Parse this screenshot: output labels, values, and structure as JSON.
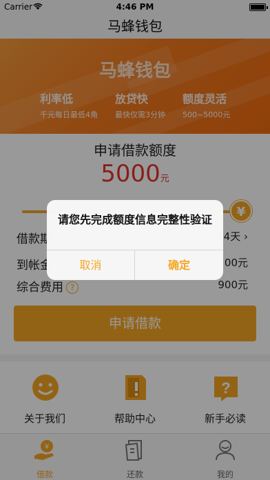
{
  "status_bar": {
    "carrier": "Carrier",
    "time": "4:46 PM"
  },
  "nav": {
    "title": "马蜂钱包"
  },
  "banner": {
    "brand": "马蜂钱包",
    "features": [
      {
        "title": "利率低",
        "subtitle": "千元每日最低4角"
      },
      {
        "title": "放贷快",
        "subtitle": "最快仅需3分钟"
      },
      {
        "title": "额度灵活",
        "subtitle": "500~5000元"
      }
    ]
  },
  "loan": {
    "apply_title": "申请借款额度",
    "amount": "5000",
    "amount_unit": "元",
    "slider_icon": "¥",
    "slider_level": 1.0,
    "rows": [
      {
        "label": "借款期",
        "value": "14天"
      },
      {
        "label": "到帐金",
        "value": "00元"
      },
      {
        "label": "综合费用",
        "value": "900元"
      }
    ],
    "apply_button": "申请借款"
  },
  "shortcuts": [
    {
      "label": "关于我们",
      "icon": "smile-face-icon"
    },
    {
      "label": "帮助中心",
      "icon": "help-book-icon"
    },
    {
      "label": "新手必读",
      "icon": "question-flag-icon"
    }
  ],
  "tabs": [
    {
      "label": "借款",
      "icon": "borrow-hand-icon",
      "active": true
    },
    {
      "label": "还款",
      "icon": "repay-doc-icon",
      "active": false
    },
    {
      "label": "我的",
      "icon": "user-icon",
      "active": false
    }
  ],
  "alert": {
    "message": "请您先完成额度信息完整性验证",
    "cancel": "取消",
    "confirm": "确定"
  },
  "colors": {
    "accent": "#f5a623",
    "amount": "#e4322b",
    "banner": "#f27a1e"
  }
}
